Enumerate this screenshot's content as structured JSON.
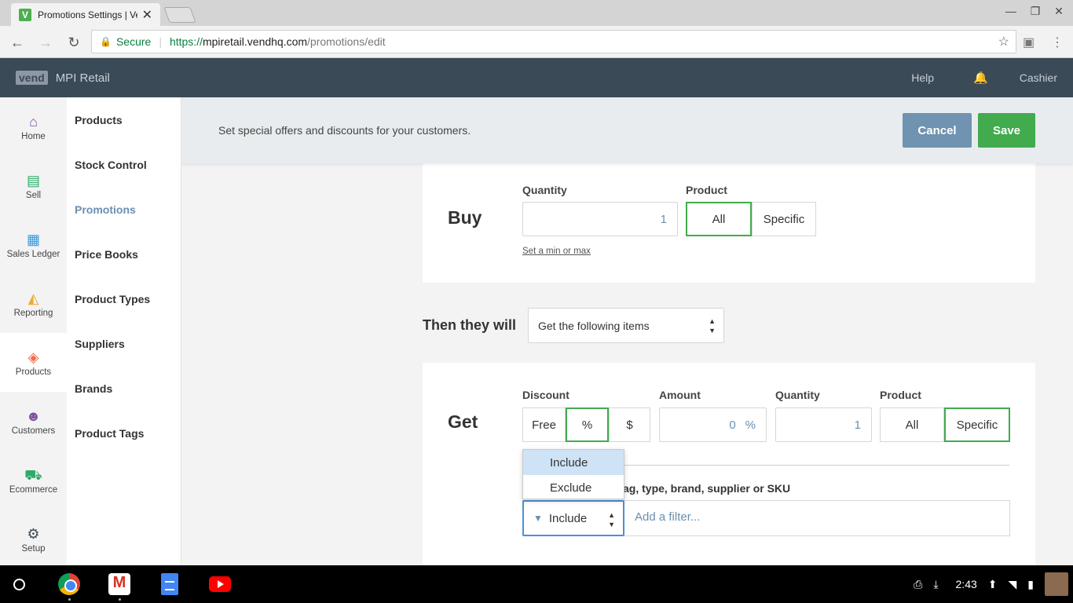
{
  "browser": {
    "tab_title": "Promotions Settings | Vend",
    "favicon_letter": "V",
    "secure_label": "Secure",
    "url_scheme": "https://",
    "url_host": "mpiretail.vendhq.com",
    "url_path": "/promotions/edit"
  },
  "app": {
    "logo": "vend",
    "store": "MPI Retail",
    "help": "Help",
    "user": "Cashier"
  },
  "nav": [
    {
      "label": "Home",
      "icon": "home-icon",
      "color": "#7a4fa0"
    },
    {
      "label": "Sell",
      "icon": "register-icon",
      "color": "#2eaa6a"
    },
    {
      "label": "Sales Ledger",
      "icon": "ledger-icon",
      "color": "#3a9ad9"
    },
    {
      "label": "Reporting",
      "icon": "chart-icon",
      "color": "#f0a830"
    },
    {
      "label": "Products",
      "icon": "tag-icon",
      "color": "#ef6b4d"
    },
    {
      "label": "Customers",
      "icon": "customers-icon",
      "color": "#7a4fa0"
    },
    {
      "label": "Ecommerce",
      "icon": "cart-icon",
      "color": "#2eaa6a"
    },
    {
      "label": "Setup",
      "icon": "gear-icon",
      "color": "#3a4a57"
    }
  ],
  "subnav": [
    "Products",
    "Stock Control",
    "Promotions",
    "Price Books",
    "Product Types",
    "Suppliers",
    "Brands",
    "Product Tags"
  ],
  "banner": {
    "text": "Set special offers and discounts for your customers.",
    "cancel": "Cancel",
    "save": "Save"
  },
  "buy": {
    "title": "Buy",
    "quantity_label": "Quantity",
    "quantity_value": "1",
    "product_label": "Product",
    "product_all": "All",
    "product_specific": "Specific",
    "minmax_link": "Set a min or max"
  },
  "then": {
    "label": "Then they will",
    "selected": "Get the following items"
  },
  "get": {
    "title": "Get",
    "discount_label": "Discount",
    "discount_free": "Free",
    "discount_pct": "%",
    "discount_dollar": "$",
    "amount_label": "Amount",
    "amount_value": "0",
    "amount_unit": "%",
    "quantity_label": "Quantity",
    "quantity_value": "1",
    "product_label": "Product",
    "product_all": "All",
    "product_specific": "Specific",
    "filter_label_visible": "ag, type, brand, supplier or SKU",
    "filter_mode": "Include",
    "filter_placeholder": "Add a filter...",
    "dropdown_options": [
      "Include",
      "Exclude"
    ]
  },
  "taskbar": {
    "time": "2:43"
  },
  "colors": {
    "header_bg": "#3a4a57",
    "accent_green": "#41ab4d",
    "cancel_blue": "#6f93b0",
    "link_blue": "#6b8fb0"
  }
}
